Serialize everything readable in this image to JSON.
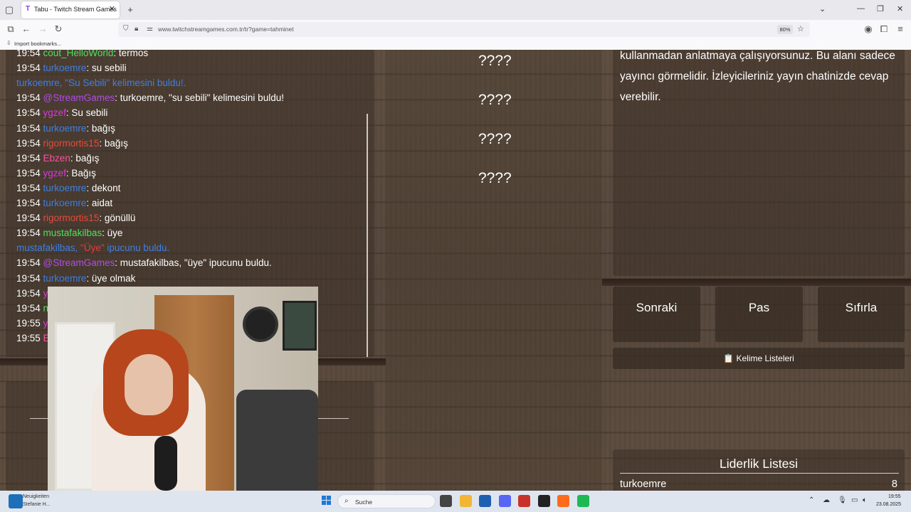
{
  "browser": {
    "tab_title": "Tabu - Twitch Stream Games",
    "tab_favicon": "T",
    "url": "www.twitchstreamgames.com.tr/tr?game=tahminet",
    "zoom": "80%",
    "bookmarks_label": "Import bookmarks..."
  },
  "chat": {
    "lines": [
      {
        "kind": "msg",
        "time": "19:54",
        "user": "cout_HelloWorld",
        "color": "#4fe05a",
        "text": ": termos"
      },
      {
        "kind": "msg",
        "time": "19:54",
        "user": "turkoemre",
        "color": "#3f7fe0",
        "text": ": su sebili"
      },
      {
        "kind": "notice",
        "pre": "turkoemre, \"Su Sebili\" kelimesini buldu!.",
        "hl": "",
        "post": ""
      },
      {
        "kind": "msg",
        "time": "19:54",
        "user": "@StreamGames",
        "color": "#b04ee8",
        "text": ": turkoemre, \"su sebili\" kelimesini buldu!"
      },
      {
        "kind": "msg",
        "time": "19:54",
        "user": "ygzef",
        "color": "#d83ad8",
        "text": ": Su sebili"
      },
      {
        "kind": "msg",
        "time": "19:54",
        "user": "turkoemre",
        "color": "#3f7fe0",
        "text": ": bağış"
      },
      {
        "kind": "msg",
        "time": "19:54",
        "user": "rigormortis15",
        "color": "#e84a3a",
        "text": ": bağış"
      },
      {
        "kind": "msg",
        "time": "19:54",
        "user": "Ebzen",
        "color": "#ff4fa0",
        "text": ": bağış"
      },
      {
        "kind": "msg",
        "time": "19:54",
        "user": "ygzef",
        "color": "#d83ad8",
        "text": ": Bağış"
      },
      {
        "kind": "msg",
        "time": "19:54",
        "user": "turkoemre",
        "color": "#3f7fe0",
        "text": ": dekont"
      },
      {
        "kind": "msg",
        "time": "19:54",
        "user": "turkoemre",
        "color": "#3f7fe0",
        "text": ": aidat"
      },
      {
        "kind": "msg",
        "time": "19:54",
        "user": "rigormortis15",
        "color": "#e84a3a",
        "text": ": gönüllü"
      },
      {
        "kind": "msg",
        "time": "19:54",
        "user": "mustafakilbas",
        "color": "#4fe05a",
        "text": ": üye"
      },
      {
        "kind": "notice",
        "pre": "mustafakilbas, ",
        "hl": "\"Üye\"",
        "post": " ipucunu buldu."
      },
      {
        "kind": "msg",
        "time": "19:54",
        "user": "@StreamGames",
        "color": "#b04ee8",
        "text": ": mustafakilbas, \"üye\" ipucunu buldu."
      },
      {
        "kind": "msg",
        "time": "19:54",
        "user": "turkoemre",
        "color": "#3f7fe0",
        "text": ": üye olmak"
      },
      {
        "kind": "msg",
        "time": "19:54",
        "user": "y",
        "color": "#d83ad8",
        "text": ""
      },
      {
        "kind": "msg",
        "time": "19:54",
        "user": "n",
        "color": "#4fe05a",
        "text": ""
      },
      {
        "kind": "msg",
        "time": "19:55",
        "user": "y",
        "color": "#d83ad8",
        "text": ""
      },
      {
        "kind": "msg",
        "time": "19:55",
        "user": "E",
        "color": "#ff4fa0",
        "text": ""
      }
    ]
  },
  "words": [
    "????",
    "????",
    "????",
    "????"
  ],
  "description": "kullanmadan anlatmaya çalışıyorsunuz. Bu alanı sadece yayıncı görmelidir. İzleyicileriniz yayın chatinizde cevap verebilir.",
  "controls": {
    "next_label": "Sonraki",
    "pass_label": "Pas",
    "reset_label": "Sıfırla",
    "lists_label": "Kelime Listeleri",
    "lists_icon": "📋"
  },
  "leaderboard": {
    "title": "Liderlik Listesi",
    "entries": [
      {
        "name": "turkoemre",
        "score": "8"
      }
    ]
  },
  "taskbar": {
    "news_line1": "Neuigkeiten",
    "news_line2": "Stefanie H...",
    "search_placeholder": "Suche",
    "time": "19:55",
    "date": "23.08.2025",
    "icons": [
      {
        "name": "task-view-icon",
        "color": "#444444"
      },
      {
        "name": "file-explorer-icon",
        "color": "#f2b632"
      },
      {
        "name": "store-icon",
        "color": "#1f5fb0"
      },
      {
        "name": "discord-icon",
        "color": "#5865f2"
      },
      {
        "name": "news-app-icon",
        "color": "#c8322a"
      },
      {
        "name": "obs-icon",
        "color": "#222222"
      },
      {
        "name": "firefox-icon",
        "color": "#ff6b1a"
      },
      {
        "name": "spotify-icon",
        "color": "#1db954"
      }
    ]
  }
}
